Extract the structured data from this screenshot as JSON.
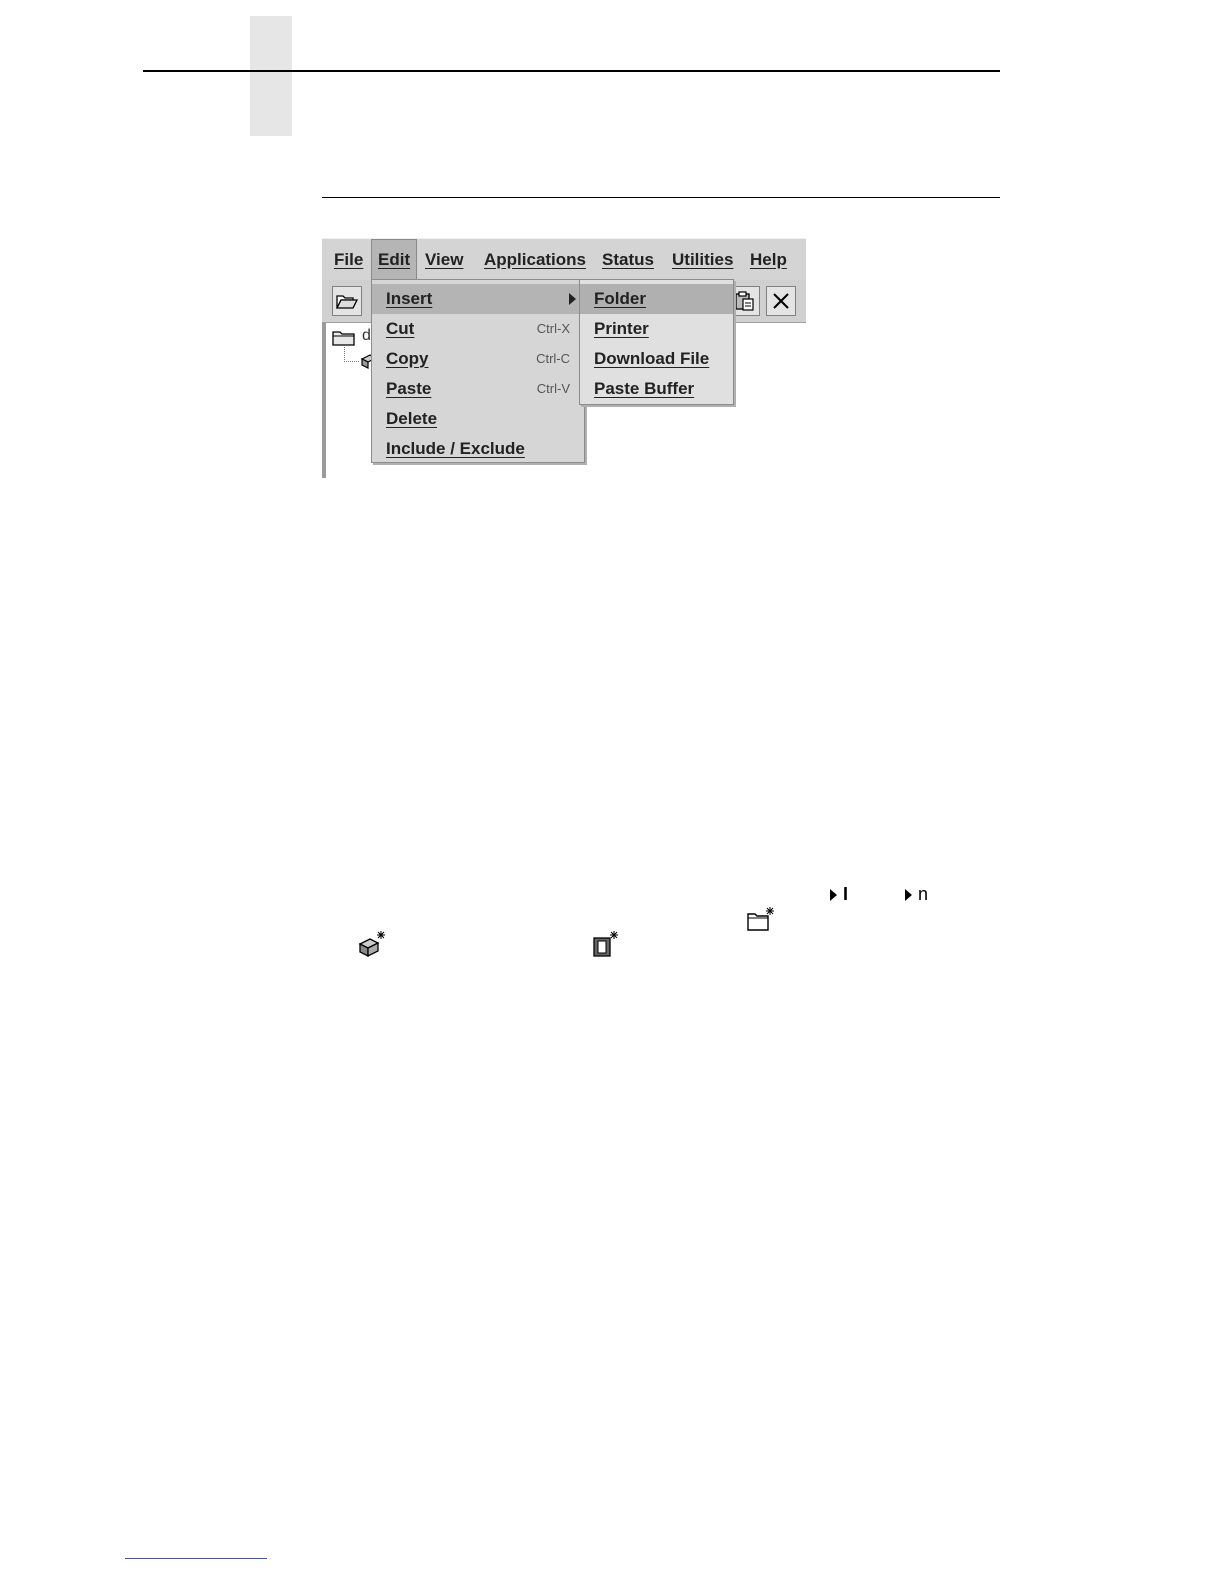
{
  "menubar": {
    "items": [
      {
        "label": "File"
      },
      {
        "label": "Edit"
      },
      {
        "label": "View"
      },
      {
        "label": "Applications"
      },
      {
        "label": "Status"
      },
      {
        "label": "Utilities"
      },
      {
        "label": "Help"
      }
    ]
  },
  "edit_menu": {
    "items": [
      {
        "label": "Insert",
        "shortcut": ""
      },
      {
        "label": "Cut",
        "shortcut": "Ctrl-X"
      },
      {
        "label": "Copy",
        "shortcut": "Ctrl-C"
      },
      {
        "label": "Paste",
        "shortcut": "Ctrl-V"
      },
      {
        "label": "Delete",
        "shortcut": ""
      },
      {
        "label": "Include / Exclude",
        "shortcut": ""
      }
    ]
  },
  "insert_submenu": {
    "items": [
      {
        "label": "Folder"
      },
      {
        "label": "Printer"
      },
      {
        "label": "Download File"
      },
      {
        "label": "Paste Buffer"
      }
    ]
  },
  "tree": {
    "root_label": "d"
  },
  "inline_text": {
    "glyph_1": "I",
    "glyph_2": "n"
  },
  "icons": {
    "toolbar_open": "open-folder-icon",
    "toolbar_paste": "clipboard-icon",
    "toolbar_delete": "close-icon",
    "new_folder": "new-folder-icon",
    "new_printer": "new-printer-icon",
    "new_download": "new-download-file-icon"
  }
}
